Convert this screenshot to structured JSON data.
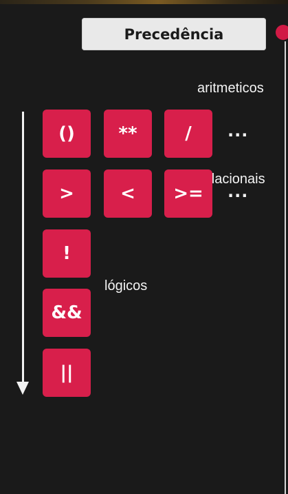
{
  "title": "Precedência",
  "labels": {
    "arithmetic": "aritmeticos",
    "relational": "relacionais",
    "logical": "lógicos"
  },
  "rows": {
    "arithmetic": {
      "keys": [
        "()",
        "**",
        "/"
      ],
      "more": "..."
    },
    "relational": {
      "keys": [
        ">",
        "<",
        ">="
      ],
      "more": "..."
    },
    "logical": {
      "keys": [
        "!",
        "&&",
        "||"
      ]
    }
  },
  "colors": {
    "key_background": "#d81f4b",
    "accent_dot": "#d11a45",
    "background": "#1a1a1a",
    "title_card": "#e9e9e9"
  }
}
